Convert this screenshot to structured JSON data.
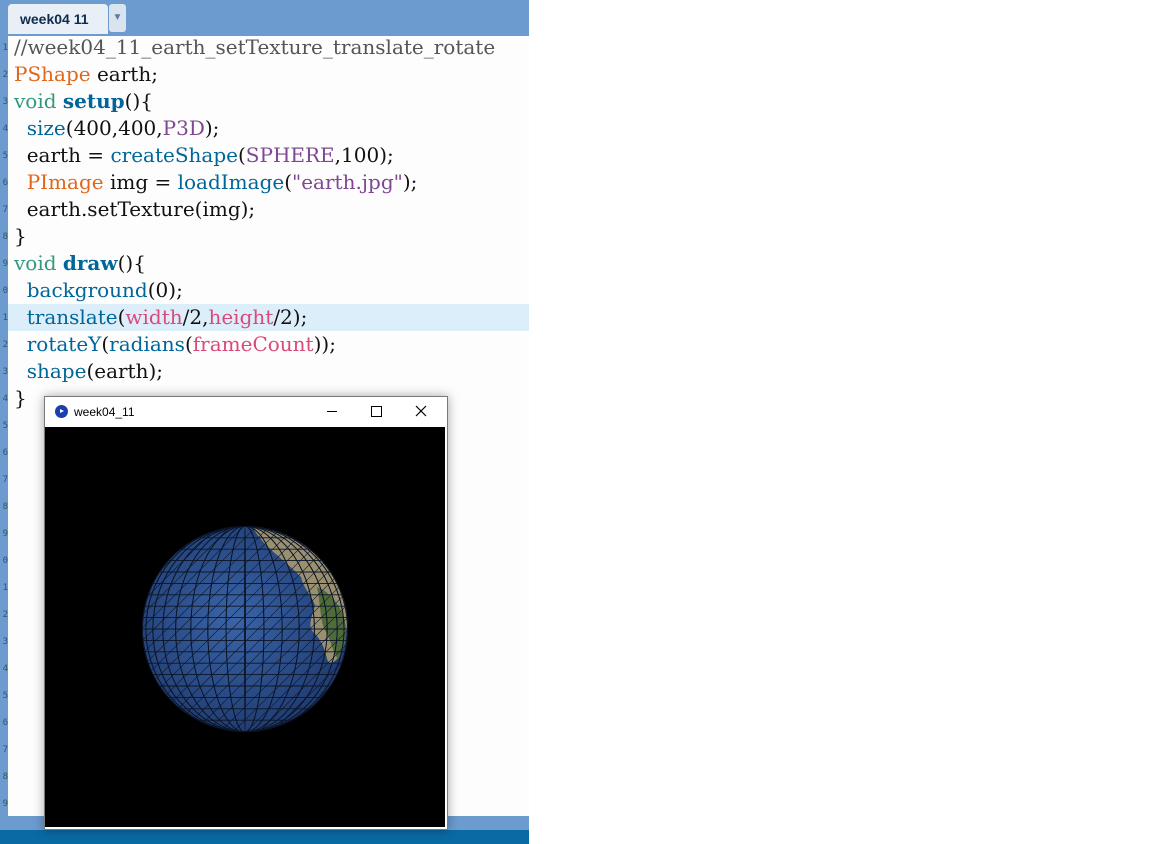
{
  "tab": {
    "label": "week04 11",
    "menu_arrow": "▼"
  },
  "editor": {
    "line_numbers": [
      "1",
      "2",
      "3",
      "4",
      "5",
      "6",
      "7",
      "8",
      "9",
      "0",
      "1",
      "2",
      "3",
      "4",
      "5",
      "6",
      "7",
      "8",
      "9",
      "0",
      "1",
      "2",
      "3",
      "4",
      "5",
      "6",
      "7",
      "8",
      "9",
      "0"
    ],
    "lines": [
      [
        {
          "t": "//week04_11_earth_setTexture_translate_rotate",
          "c": "comment"
        }
      ],
      [
        {
          "t": "PShape",
          "c": "type"
        },
        {
          "t": " earth;",
          "c": ""
        }
      ],
      [
        {
          "t": "void",
          "c": "kw"
        },
        {
          "t": " ",
          "c": ""
        },
        {
          "t": "setup",
          "c": "fnb"
        },
        {
          "t": "(){",
          "c": ""
        }
      ],
      [
        {
          "t": "  ",
          "c": ""
        },
        {
          "t": "size",
          "c": "fn"
        },
        {
          "t": "(400,400,",
          "c": ""
        },
        {
          "t": "P3D",
          "c": "const"
        },
        {
          "t": ");",
          "c": ""
        }
      ],
      [
        {
          "t": "  earth = ",
          "c": ""
        },
        {
          "t": "createShape",
          "c": "fn"
        },
        {
          "t": "(",
          "c": ""
        },
        {
          "t": "SPHERE",
          "c": "const"
        },
        {
          "t": ",100);",
          "c": ""
        }
      ],
      [
        {
          "t": "  ",
          "c": ""
        },
        {
          "t": "PImage",
          "c": "type"
        },
        {
          "t": " img = ",
          "c": ""
        },
        {
          "t": "loadImage",
          "c": "fn"
        },
        {
          "t": "(",
          "c": ""
        },
        {
          "t": "\"earth.jpg\"",
          "c": "str"
        },
        {
          "t": ");",
          "c": ""
        }
      ],
      [
        {
          "t": "  earth.setTexture(img);",
          "c": ""
        }
      ],
      [
        {
          "t": "}",
          "c": ""
        }
      ],
      [
        {
          "t": "void",
          "c": "kw"
        },
        {
          "t": " ",
          "c": ""
        },
        {
          "t": "draw",
          "c": "fnb"
        },
        {
          "t": "(){",
          "c": ""
        }
      ],
      [
        {
          "t": "  ",
          "c": ""
        },
        {
          "t": "background",
          "c": "fn"
        },
        {
          "t": "(0);",
          "c": ""
        }
      ],
      [
        {
          "t": "  ",
          "c": ""
        },
        {
          "t": "translate",
          "c": "fn"
        },
        {
          "t": "(",
          "c": ""
        },
        {
          "t": "width",
          "c": "var"
        },
        {
          "t": "/2,",
          "c": ""
        },
        {
          "t": "height",
          "c": "var"
        },
        {
          "t": "/2);",
          "c": ""
        }
      ],
      [
        {
          "t": "  ",
          "c": ""
        },
        {
          "t": "rotateY",
          "c": "fn"
        },
        {
          "t": "(",
          "c": ""
        },
        {
          "t": "radians",
          "c": "fn"
        },
        {
          "t": "(",
          "c": ""
        },
        {
          "t": "frameCount",
          "c": "var"
        },
        {
          "t": "));",
          "c": ""
        }
      ],
      [
        {
          "t": "  ",
          "c": ""
        },
        {
          "t": "shape",
          "c": "fn"
        },
        {
          "t": "(earth);",
          "c": ""
        }
      ],
      [
        {
          "t": "}",
          "c": ""
        }
      ]
    ],
    "highlighted_line": 11
  },
  "sketch_window": {
    "title": "week04_11",
    "minimize_icon": "minimize-icon",
    "maximize_icon": "maximize-icon",
    "close_icon": "close-icon",
    "background": "#000000",
    "sphere_ocean_color": "#2a4b86",
    "sphere_land_color": "#8a8460"
  },
  "colors": {
    "tabbar": "#6b9bcf",
    "status_bar": "#0a6aa3",
    "highlight": "#dceef9"
  }
}
